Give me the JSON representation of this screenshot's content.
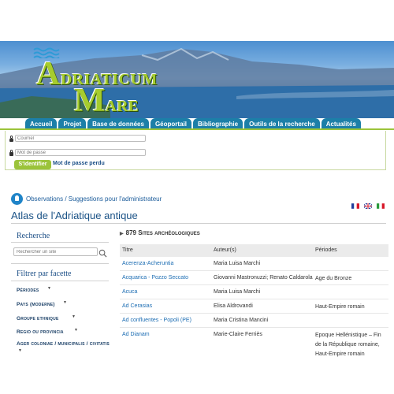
{
  "site": {
    "logo_line1": "Adriaticum",
    "logo_line2": "Mare"
  },
  "nav": {
    "tabs": [
      "Accueil",
      "Projet",
      "Base de données",
      "Géoportail",
      "Bibliographie",
      "Outils de la recherche",
      "Actualités"
    ]
  },
  "login": {
    "username_placeholder": "Courriel",
    "password_placeholder": "Mot de passe",
    "submit_label": "S'identifier",
    "forgot_label": "Mot de passe perdu"
  },
  "suggestions": {
    "label": "Observations / Suggestions pour l'administrateur"
  },
  "languages": [
    {
      "code": "fr",
      "colors": [
        "#1f3d9b",
        "#ffffff",
        "#d7192a"
      ]
    },
    {
      "code": "en",
      "colors": [
        "#1f3d9b",
        "#ffffff",
        "#d7192a"
      ]
    },
    {
      "code": "it",
      "colors": [
        "#2a9a3b",
        "#ffffff",
        "#d7192a"
      ]
    }
  ],
  "page": {
    "title": "Atlas de l'Adriatique antique"
  },
  "sidebar": {
    "search_heading": "Recherche",
    "search_placeholder": "Rechercher un site",
    "filter_heading": "Filtrer par facette",
    "facets": [
      "Périodes",
      "Pays (moderne)",
      "Groupe ethnique",
      "Regio ou provincia",
      "Ager coloniae / municipalis / civitatis"
    ]
  },
  "results": {
    "count_label": "879 Sites archéologiques",
    "columns": [
      "Titre",
      "Auteur(s)",
      "Périodes"
    ],
    "rows": [
      {
        "title": "Acerenza-Acheruntia",
        "authors": "Maria Luisa Marchi",
        "periods": ""
      },
      {
        "title": "Acquarica - Pozzo Seccato",
        "authors": "Giovanni Mastronuzzi; Renato Caldarola",
        "periods": "Age du Bronze"
      },
      {
        "title": "Acuca",
        "authors": "Maria Luisa Marchi",
        "periods": ""
      },
      {
        "title": "Ad Cerasias",
        "authors": "Elisa Aldrovandi",
        "periods": "Haut-Empire romain"
      },
      {
        "title": "Ad confluentes - Popoli (PE)",
        "authors": "Maria Cristina Mancini",
        "periods": ""
      },
      {
        "title": "Ad Dianam",
        "authors": "Marie-Claire Ferriès",
        "periods": "Epoque Hellénistique – Fin de la République romaine, Haut-Empire romain"
      }
    ]
  },
  "colors": {
    "nav_tab": "#1c7fa8",
    "accent_green": "#9bc33a",
    "link_blue": "#1c6db3",
    "title_blue": "#1a5286"
  }
}
